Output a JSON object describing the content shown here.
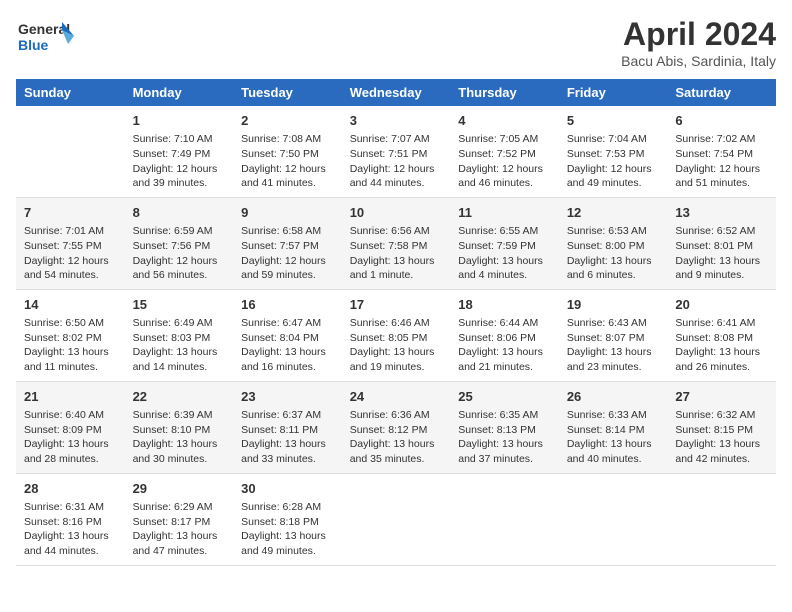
{
  "header": {
    "logo_line1": "General",
    "logo_line2": "Blue",
    "month_title": "April 2024",
    "location": "Bacu Abis, Sardinia, Italy"
  },
  "columns": [
    "Sunday",
    "Monday",
    "Tuesday",
    "Wednesday",
    "Thursday",
    "Friday",
    "Saturday"
  ],
  "weeks": [
    [
      {
        "day": "",
        "info": ""
      },
      {
        "day": "1",
        "info": "Sunrise: 7:10 AM\nSunset: 7:49 PM\nDaylight: 12 hours\nand 39 minutes."
      },
      {
        "day": "2",
        "info": "Sunrise: 7:08 AM\nSunset: 7:50 PM\nDaylight: 12 hours\nand 41 minutes."
      },
      {
        "day": "3",
        "info": "Sunrise: 7:07 AM\nSunset: 7:51 PM\nDaylight: 12 hours\nand 44 minutes."
      },
      {
        "day": "4",
        "info": "Sunrise: 7:05 AM\nSunset: 7:52 PM\nDaylight: 12 hours\nand 46 minutes."
      },
      {
        "day": "5",
        "info": "Sunrise: 7:04 AM\nSunset: 7:53 PM\nDaylight: 12 hours\nand 49 minutes."
      },
      {
        "day": "6",
        "info": "Sunrise: 7:02 AM\nSunset: 7:54 PM\nDaylight: 12 hours\nand 51 minutes."
      }
    ],
    [
      {
        "day": "7",
        "info": "Sunrise: 7:01 AM\nSunset: 7:55 PM\nDaylight: 12 hours\nand 54 minutes."
      },
      {
        "day": "8",
        "info": "Sunrise: 6:59 AM\nSunset: 7:56 PM\nDaylight: 12 hours\nand 56 minutes."
      },
      {
        "day": "9",
        "info": "Sunrise: 6:58 AM\nSunset: 7:57 PM\nDaylight: 12 hours\nand 59 minutes."
      },
      {
        "day": "10",
        "info": "Sunrise: 6:56 AM\nSunset: 7:58 PM\nDaylight: 13 hours\nand 1 minute."
      },
      {
        "day": "11",
        "info": "Sunrise: 6:55 AM\nSunset: 7:59 PM\nDaylight: 13 hours\nand 4 minutes."
      },
      {
        "day": "12",
        "info": "Sunrise: 6:53 AM\nSunset: 8:00 PM\nDaylight: 13 hours\nand 6 minutes."
      },
      {
        "day": "13",
        "info": "Sunrise: 6:52 AM\nSunset: 8:01 PM\nDaylight: 13 hours\nand 9 minutes."
      }
    ],
    [
      {
        "day": "14",
        "info": "Sunrise: 6:50 AM\nSunset: 8:02 PM\nDaylight: 13 hours\nand 11 minutes."
      },
      {
        "day": "15",
        "info": "Sunrise: 6:49 AM\nSunset: 8:03 PM\nDaylight: 13 hours\nand 14 minutes."
      },
      {
        "day": "16",
        "info": "Sunrise: 6:47 AM\nSunset: 8:04 PM\nDaylight: 13 hours\nand 16 minutes."
      },
      {
        "day": "17",
        "info": "Sunrise: 6:46 AM\nSunset: 8:05 PM\nDaylight: 13 hours\nand 19 minutes."
      },
      {
        "day": "18",
        "info": "Sunrise: 6:44 AM\nSunset: 8:06 PM\nDaylight: 13 hours\nand 21 minutes."
      },
      {
        "day": "19",
        "info": "Sunrise: 6:43 AM\nSunset: 8:07 PM\nDaylight: 13 hours\nand 23 minutes."
      },
      {
        "day": "20",
        "info": "Sunrise: 6:41 AM\nSunset: 8:08 PM\nDaylight: 13 hours\nand 26 minutes."
      }
    ],
    [
      {
        "day": "21",
        "info": "Sunrise: 6:40 AM\nSunset: 8:09 PM\nDaylight: 13 hours\nand 28 minutes."
      },
      {
        "day": "22",
        "info": "Sunrise: 6:39 AM\nSunset: 8:10 PM\nDaylight: 13 hours\nand 30 minutes."
      },
      {
        "day": "23",
        "info": "Sunrise: 6:37 AM\nSunset: 8:11 PM\nDaylight: 13 hours\nand 33 minutes."
      },
      {
        "day": "24",
        "info": "Sunrise: 6:36 AM\nSunset: 8:12 PM\nDaylight: 13 hours\nand 35 minutes."
      },
      {
        "day": "25",
        "info": "Sunrise: 6:35 AM\nSunset: 8:13 PM\nDaylight: 13 hours\nand 37 minutes."
      },
      {
        "day": "26",
        "info": "Sunrise: 6:33 AM\nSunset: 8:14 PM\nDaylight: 13 hours\nand 40 minutes."
      },
      {
        "day": "27",
        "info": "Sunrise: 6:32 AM\nSunset: 8:15 PM\nDaylight: 13 hours\nand 42 minutes."
      }
    ],
    [
      {
        "day": "28",
        "info": "Sunrise: 6:31 AM\nSunset: 8:16 PM\nDaylight: 13 hours\nand 44 minutes."
      },
      {
        "day": "29",
        "info": "Sunrise: 6:29 AM\nSunset: 8:17 PM\nDaylight: 13 hours\nand 47 minutes."
      },
      {
        "day": "30",
        "info": "Sunrise: 6:28 AM\nSunset: 8:18 PM\nDaylight: 13 hours\nand 49 minutes."
      },
      {
        "day": "",
        "info": ""
      },
      {
        "day": "",
        "info": ""
      },
      {
        "day": "",
        "info": ""
      },
      {
        "day": "",
        "info": ""
      }
    ]
  ]
}
